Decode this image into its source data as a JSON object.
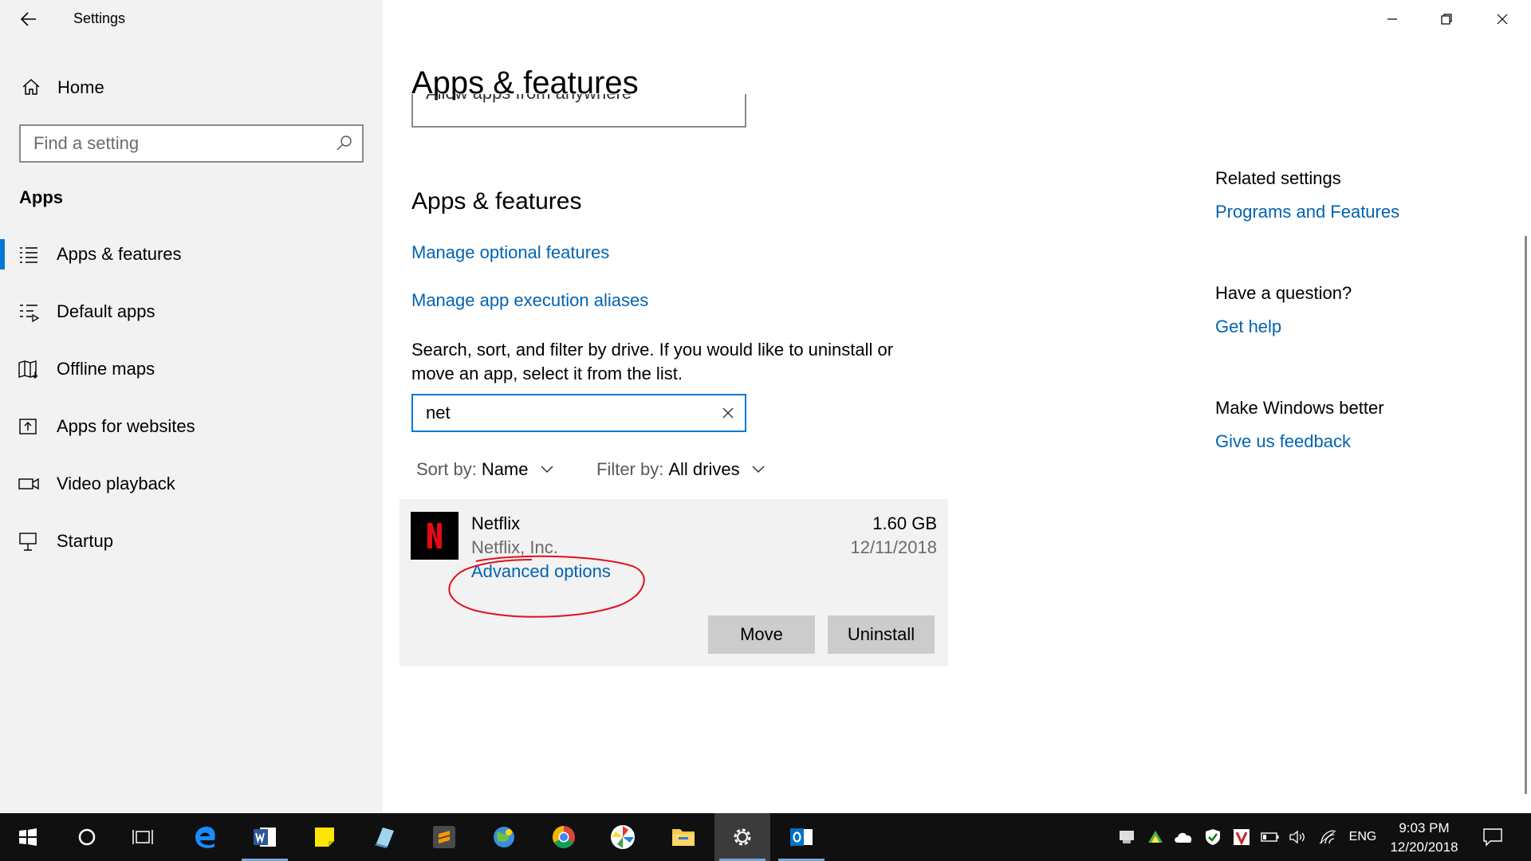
{
  "window": {
    "title": "Settings"
  },
  "sidebar": {
    "home_label": "Home",
    "search_placeholder": "Find a setting",
    "section": "Apps",
    "items": [
      {
        "label": "Apps & features",
        "icon": "list-icon",
        "active": true
      },
      {
        "label": "Default apps",
        "icon": "default-apps-icon"
      },
      {
        "label": "Offline maps",
        "icon": "map-icon"
      },
      {
        "label": "Apps for websites",
        "icon": "open-in-app-icon"
      },
      {
        "label": "Video playback",
        "icon": "video-icon"
      },
      {
        "label": "Startup",
        "icon": "startup-icon"
      }
    ]
  },
  "main": {
    "page_title": "Apps & features",
    "partial_dropdown_text": "Allow apps from anywhere",
    "section_title": "Apps & features",
    "link_optional": "Manage optional features",
    "link_aliases": "Manage app execution aliases",
    "description": "Search, sort, and filter by drive. If you would like to uninstall or move an app, select it from the list.",
    "search_value": "net",
    "sort_label": "Sort by:",
    "sort_value": "Name",
    "filter_label": "Filter by:",
    "filter_value": "All drives",
    "app": {
      "name": "Netflix",
      "publisher": "Netflix, Inc.",
      "size": "1.60 GB",
      "date": "12/11/2018",
      "advanced_link": "Advanced options",
      "move_label": "Move",
      "uninstall_label": "Uninstall",
      "logo_letter": "N"
    }
  },
  "right": {
    "related_heading": "Related settings",
    "related_link": "Programs and Features",
    "question_heading": "Have a question?",
    "question_link": "Get help",
    "better_heading": "Make Windows better",
    "better_link": "Give us feedback"
  },
  "taskbar": {
    "language": "ENG",
    "time": "9:03 PM",
    "date": "12/20/2018"
  },
  "colors": {
    "accent": "#0078d7",
    "link": "#0063b1",
    "sidebar_bg": "#f2f2f2",
    "taskbar_bg": "#101010",
    "annotation_red": "#e0101e",
    "netflix_red": "#e50914"
  }
}
